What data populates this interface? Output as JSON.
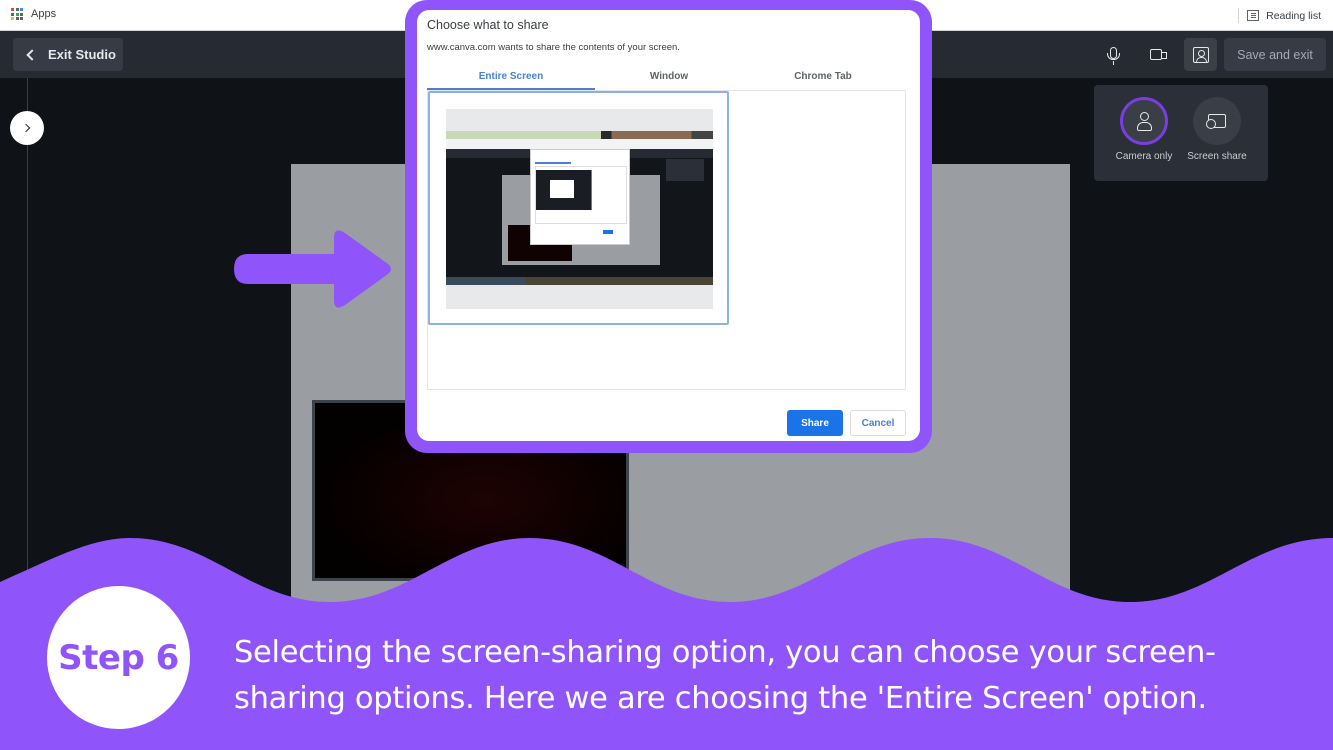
{
  "browser": {
    "bookmarks": {
      "apps_label": "Apps",
      "reading_list_label": "Reading list"
    }
  },
  "studio_bar": {
    "exit_label": "Exit Studio",
    "save_label": "Save and exit",
    "icons": [
      "microphone-icon",
      "camera-icon",
      "person-frame-icon"
    ]
  },
  "recording_modes": {
    "options": [
      {
        "label": "Camera only",
        "icon": "person-icon",
        "selected": true
      },
      {
        "label": "Screen share",
        "icon": "screen-share-icon",
        "selected": false
      }
    ]
  },
  "share_dialog": {
    "title": "Choose what to share",
    "subtitle": "www.canva.com wants to share the contents of your screen.",
    "tabs": [
      {
        "label": "Entire Screen",
        "active": true
      },
      {
        "label": "Window",
        "active": false
      },
      {
        "label": "Chrome Tab",
        "active": false
      }
    ],
    "share_label": "Share",
    "cancel_label": "Cancel"
  },
  "tutorial": {
    "step_label": "Step 6",
    "caption_lines": [
      "Selecting the screen-sharing option, you can choose your screen-",
      "sharing options. Here we are choosing the 'Entire Screen' option."
    ],
    "accent_color": "#8f55fb"
  }
}
